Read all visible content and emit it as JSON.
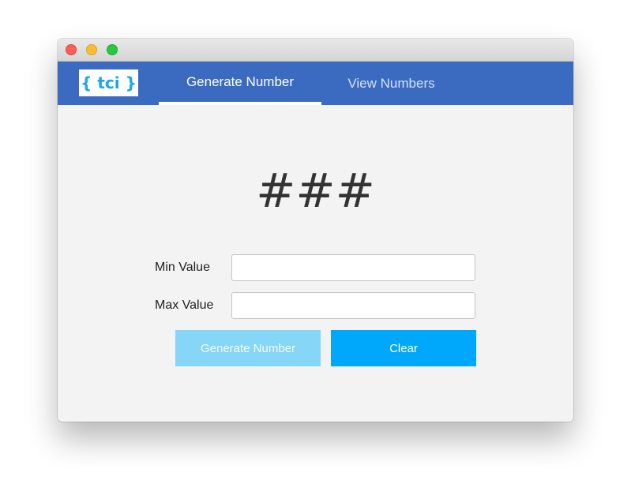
{
  "window": {
    "buttons": [
      "close",
      "minimize",
      "maximize"
    ]
  },
  "navbar": {
    "logo_text": "{ tci }",
    "tabs": [
      {
        "label": "Generate Number",
        "active": true
      },
      {
        "label": "View Numbers",
        "active": false
      }
    ]
  },
  "main": {
    "result_display": "###",
    "min_label": "Min Value",
    "min_value": "",
    "max_label": "Max Value",
    "max_value": "",
    "generate_button": "Generate Number",
    "clear_button": "Clear"
  },
  "colors": {
    "navbar": "#3a6bc1",
    "logo_text": "#1aa7ec",
    "generate_button_disabled": "#86d6f7",
    "clear_button": "#00a8fb"
  }
}
